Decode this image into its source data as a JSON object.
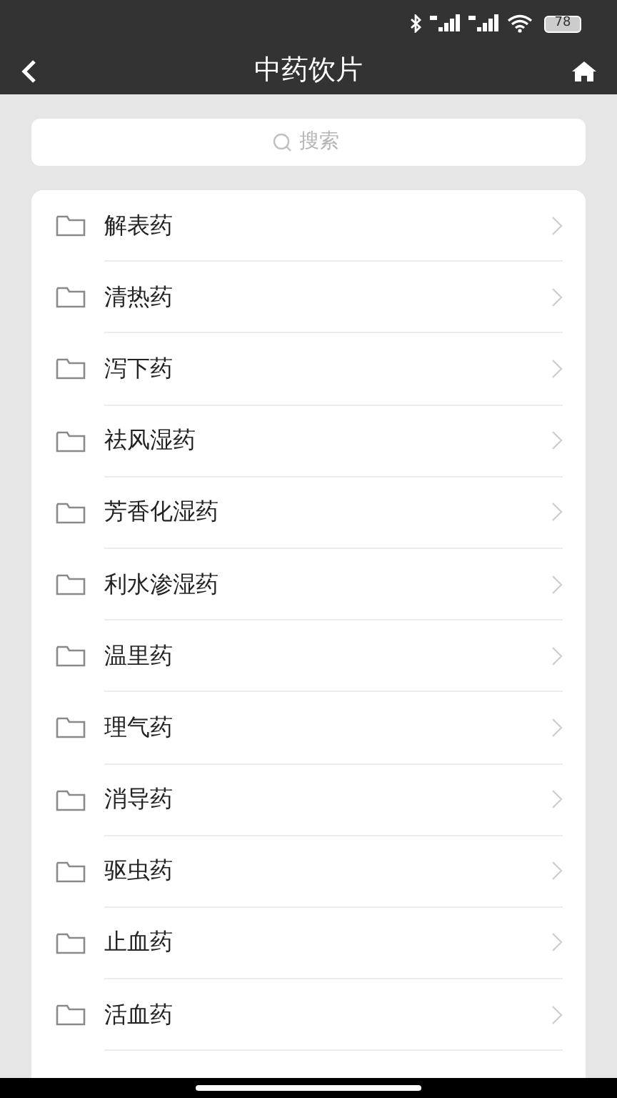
{
  "status_bar": {
    "battery": "78"
  },
  "header": {
    "title": "中药饮片"
  },
  "search": {
    "placeholder": "搜索"
  },
  "categories": [
    {
      "label": "解表药"
    },
    {
      "label": "清热药"
    },
    {
      "label": "泻下药"
    },
    {
      "label": "祛风湿药"
    },
    {
      "label": "芳香化湿药"
    },
    {
      "label": "利水渗湿药"
    },
    {
      "label": "温里药"
    },
    {
      "label": "理气药"
    },
    {
      "label": "消导药"
    },
    {
      "label": "驱虫药"
    },
    {
      "label": "止血药"
    },
    {
      "label": "活血药"
    }
  ]
}
